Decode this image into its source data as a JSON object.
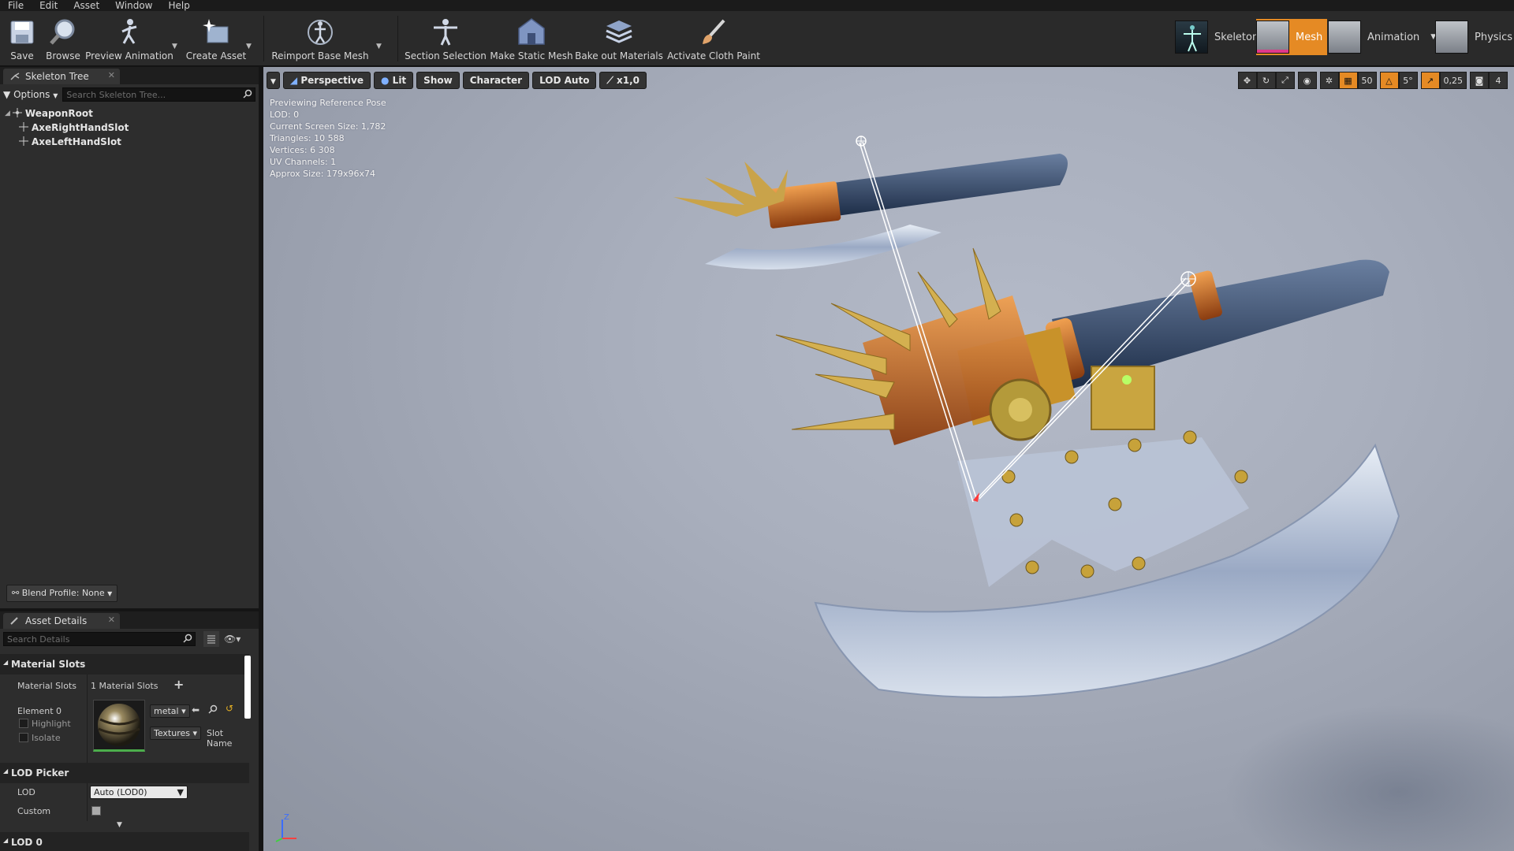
{
  "menu": [
    "File",
    "Edit",
    "Asset",
    "Window",
    "Help"
  ],
  "toolbar": {
    "save": "Save",
    "browse": "Browse",
    "preview_animation": "Preview Animation",
    "create_asset": "Create Asset",
    "reimport": "Reimport Base Mesh",
    "section_selection": "Section Selection",
    "make_static": "Make Static Mesh",
    "bake_materials": "Bake out Materials",
    "cloth_paint": "Activate Cloth Paint"
  },
  "modes": {
    "skeleton": "Skeleton",
    "mesh": "Mesh",
    "animation": "Animation",
    "physics": "Physics"
  },
  "skeleton_tree": {
    "tab": "Skeleton Tree",
    "options": "Options",
    "search_placeholder": "Search Skeleton Tree...",
    "nodes": [
      "WeaponRoot",
      "AxeRightHandSlot",
      "AxeLeftHandSlot"
    ],
    "blend_profile": "Blend Profile: None"
  },
  "details": {
    "tab": "Asset Details",
    "search_placeholder": "Search Details",
    "material_slots_header": "Material Slots",
    "material_slots_label": "Material Slots",
    "material_slots_value": "1 Material Slots",
    "element": "Element 0",
    "highlight": "Highlight",
    "isolate": "Isolate",
    "material_name": "metal",
    "textures": "Textures",
    "slot_name": "Slot Name",
    "lod_picker_header": "LOD Picker",
    "lod_label": "LOD",
    "lod_value": "Auto (LOD0)",
    "custom_label": "Custom",
    "lod0_header": "LOD 0"
  },
  "viewport": {
    "perspective": "Perspective",
    "lit": "Lit",
    "show": "Show",
    "character": "Character",
    "lod_auto": "LOD Auto",
    "speed": "x1,0",
    "grid_snap": "50",
    "rot_snap": "5°",
    "scale_snap": "0,25",
    "cam_speed": "4",
    "stats": [
      "Previewing Reference Pose",
      "LOD: 0",
      "Current Screen Size: 1,782",
      "Triangles: 10 588",
      "Vertices: 6 308",
      "UV Channels: 1",
      "Approx Size: 179x96x74"
    ]
  },
  "colors": {
    "accent": "#e58a24",
    "panel": "#2d2d2d",
    "toolbar": "#2a2a2a"
  }
}
